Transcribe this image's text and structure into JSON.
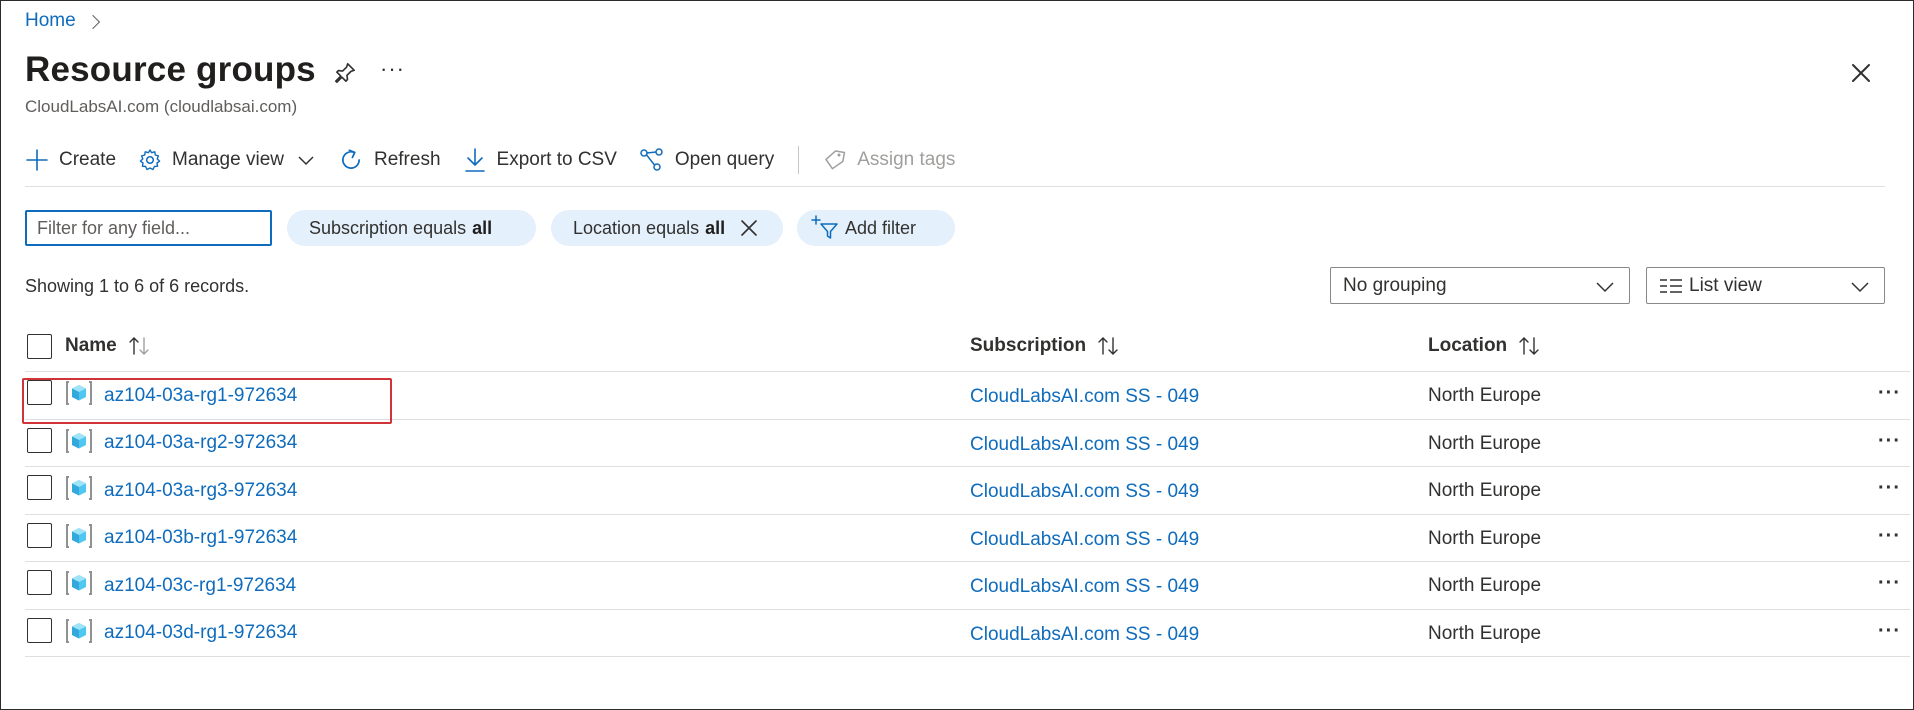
{
  "breadcrumb": {
    "home": "Home"
  },
  "header": {
    "title": "Resource groups",
    "subtitle": "CloudLabsAI.com (cloudlabsai.com)",
    "more": "···"
  },
  "toolbar": {
    "create": "Create",
    "manage_view": "Manage view",
    "refresh": "Refresh",
    "export_csv": "Export to CSV",
    "open_query": "Open query",
    "assign_tags": "Assign tags"
  },
  "filters": {
    "search_placeholder": "Filter for any field...",
    "subscription_pill": {
      "label": "Subscription equals",
      "value": "all"
    },
    "location_pill": {
      "label": "Location equals",
      "value": "all"
    },
    "add_filter": "Add filter"
  },
  "records_text": "Showing 1 to 6 of 6 records.",
  "grouping": {
    "selected": "No grouping"
  },
  "view": {
    "selected": "List view"
  },
  "table": {
    "columns": {
      "name": "Name",
      "subscription": "Subscription",
      "location": "Location"
    },
    "rows": [
      {
        "name": "az104-03a-rg1-972634",
        "subscription": "CloudLabsAI.com SS - 049",
        "location": "North Europe"
      },
      {
        "name": "az104-03a-rg2-972634",
        "subscription": "CloudLabsAI.com SS - 049",
        "location": "North Europe"
      },
      {
        "name": "az104-03a-rg3-972634",
        "subscription": "CloudLabsAI.com SS - 049",
        "location": "North Europe"
      },
      {
        "name": "az104-03b-rg1-972634",
        "subscription": "CloudLabsAI.com SS - 049",
        "location": "North Europe"
      },
      {
        "name": "az104-03c-rg1-972634",
        "subscription": "CloudLabsAI.com SS - 049",
        "location": "North Europe"
      },
      {
        "name": "az104-03d-rg1-972634",
        "subscription": "CloudLabsAI.com SS - 049",
        "location": "North Europe"
      }
    ],
    "row_more": "···"
  },
  "colors": {
    "accent": "#0f6cbd",
    "pill_bg": "#e4f0fb",
    "highlight": "#d13438"
  }
}
